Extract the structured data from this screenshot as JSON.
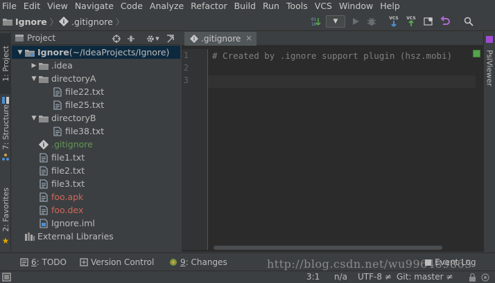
{
  "menu": [
    "File",
    "Edit",
    "View",
    "Navigate",
    "Code",
    "Analyze",
    "Refactor",
    "Build",
    "Run",
    "Tools",
    "VCS",
    "Window",
    "Help"
  ],
  "breadcrumb": {
    "project": "Ignore",
    "file": ".gitignore"
  },
  "toolbar": {
    "vcs_label_1": "VCS",
    "vcs_label_2": "VCS"
  },
  "left_tabs": {
    "project": "1: Project",
    "structure": "7: Structure",
    "favorites": "2: Favorites"
  },
  "right_tabs": {
    "psiviewer": "PsiViewer"
  },
  "project_panel": {
    "title": "Project",
    "tree": [
      {
        "label": "Ignore",
        "suffix": " (~/IdeaProjects/Ignore)",
        "depth": 0,
        "arrow": "down",
        "icon": "module-folder",
        "color": "#bbbbbb",
        "bold": true,
        "selected": true
      },
      {
        "label": ".idea",
        "depth": 1,
        "arrow": "right",
        "icon": "folder",
        "color": "#bbbbbb"
      },
      {
        "label": "directoryA",
        "depth": 1,
        "arrow": "down",
        "icon": "folder",
        "color": "#bbbbbb"
      },
      {
        "label": "file22.txt",
        "depth": 2,
        "arrow": "",
        "icon": "text-file",
        "color": "#bbbbbb"
      },
      {
        "label": "file25.txt",
        "depth": 2,
        "arrow": "",
        "icon": "text-file",
        "color": "#bbbbbb"
      },
      {
        "label": "directoryB",
        "depth": 1,
        "arrow": "down",
        "icon": "folder",
        "color": "#bbbbbb"
      },
      {
        "label": "file38.txt",
        "depth": 2,
        "arrow": "",
        "icon": "text-file",
        "color": "#bbbbbb"
      },
      {
        "label": ".gitignore",
        "depth": 1,
        "arrow": "",
        "icon": "gitignore",
        "color": "#629755"
      },
      {
        "label": "file1.txt",
        "depth": 1,
        "arrow": "",
        "icon": "text-file",
        "color": "#bbbbbb"
      },
      {
        "label": "file2.txt",
        "depth": 1,
        "arrow": "",
        "icon": "text-file",
        "color": "#bbbbbb"
      },
      {
        "label": "file3.txt",
        "depth": 1,
        "arrow": "",
        "icon": "text-file",
        "color": "#bbbbbb"
      },
      {
        "label": "foo.apk",
        "depth": 1,
        "arrow": "",
        "icon": "text-file",
        "color": "#d1675a"
      },
      {
        "label": "foo.dex",
        "depth": 1,
        "arrow": "",
        "icon": "text-file",
        "color": "#d1675a"
      },
      {
        "label": "Ignore.iml",
        "depth": 1,
        "arrow": "",
        "icon": "iml-file",
        "color": "#bbbbbb"
      },
      {
        "label": "External Libraries",
        "depth": 0,
        "arrow": "",
        "icon": "libraries",
        "color": "#bbbbbb"
      }
    ]
  },
  "editor": {
    "tab": ".gitignore",
    "line_numbers": [
      "1",
      "2",
      "3"
    ],
    "lines": [
      "# Created by .ignore support plugin (hsz.mobi)",
      "",
      ""
    ]
  },
  "bottom_tabs": {
    "todo_key": "6",
    "todo": ": TODO",
    "vc": "Version Control",
    "changes_key": "9",
    "changes": ": Changes",
    "event_log": "Event Log"
  },
  "status": {
    "position": "3:1",
    "line_sep": "n/a",
    "encoding": "UTF-8 ≠",
    "git": "Git: master ≠"
  },
  "watermark": "http://blog.csdn.net/wu996489865",
  "colors": {
    "background": "#3c3f41",
    "editor_bg": "#2b2b2b",
    "selection": "#0d293e",
    "ignored_file": "#d1675a",
    "new_file": "#629755",
    "comment": "#808080"
  }
}
